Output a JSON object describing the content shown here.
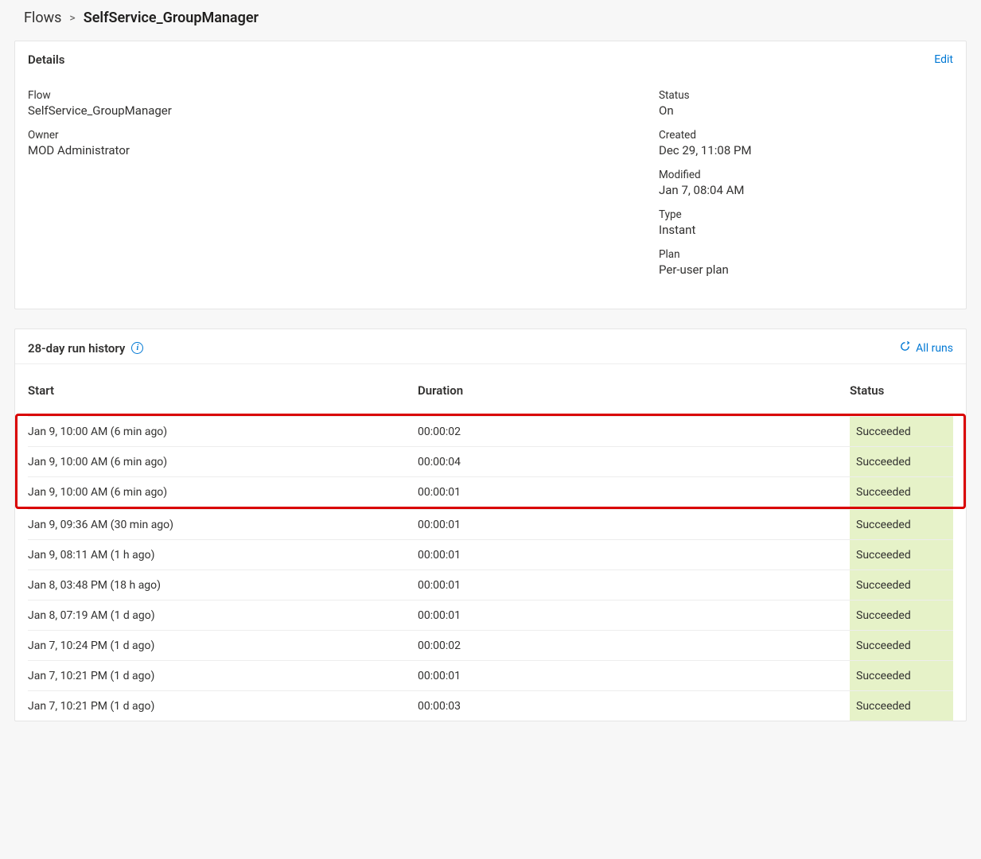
{
  "breadcrumb": {
    "root": "Flows",
    "current": "SelfService_GroupManager"
  },
  "details": {
    "title": "Details",
    "edit": "Edit",
    "fields": {
      "flow_label": "Flow",
      "flow_value": "SelfService_GroupManager",
      "owner_label": "Owner",
      "owner_value": "MOD Administrator",
      "status_label": "Status",
      "status_value": "On",
      "created_label": "Created",
      "created_value": "Dec 29, 11:08 PM",
      "modified_label": "Modified",
      "modified_value": "Jan 7, 08:04 AM",
      "type_label": "Type",
      "type_value": "Instant",
      "plan_label": "Plan",
      "plan_value": "Per-user plan"
    }
  },
  "history": {
    "title": "28-day run history",
    "all_runs": "All runs",
    "columns": {
      "start": "Start",
      "duration": "Duration",
      "status": "Status"
    },
    "highlighted": [
      {
        "start": "Jan 9, 10:00 AM (6 min ago)",
        "duration": "00:00:02",
        "status": "Succeeded"
      },
      {
        "start": "Jan 9, 10:00 AM (6 min ago)",
        "duration": "00:00:04",
        "status": "Succeeded"
      },
      {
        "start": "Jan 9, 10:00 AM (6 min ago)",
        "duration": "00:00:01",
        "status": "Succeeded"
      }
    ],
    "rows": [
      {
        "start": "Jan 9, 09:36 AM (30 min ago)",
        "duration": "00:00:01",
        "status": "Succeeded"
      },
      {
        "start": "Jan 9, 08:11 AM (1 h ago)",
        "duration": "00:00:01",
        "status": "Succeeded"
      },
      {
        "start": "Jan 8, 03:48 PM (18 h ago)",
        "duration": "00:00:01",
        "status": "Succeeded"
      },
      {
        "start": "Jan 8, 07:19 AM (1 d ago)",
        "duration": "00:00:01",
        "status": "Succeeded"
      },
      {
        "start": "Jan 7, 10:24 PM (1 d ago)",
        "duration": "00:00:02",
        "status": "Succeeded"
      },
      {
        "start": "Jan 7, 10:21 PM (1 d ago)",
        "duration": "00:00:01",
        "status": "Succeeded"
      },
      {
        "start": "Jan 7, 10:21 PM (1 d ago)",
        "duration": "00:00:03",
        "status": "Succeeded"
      }
    ]
  }
}
